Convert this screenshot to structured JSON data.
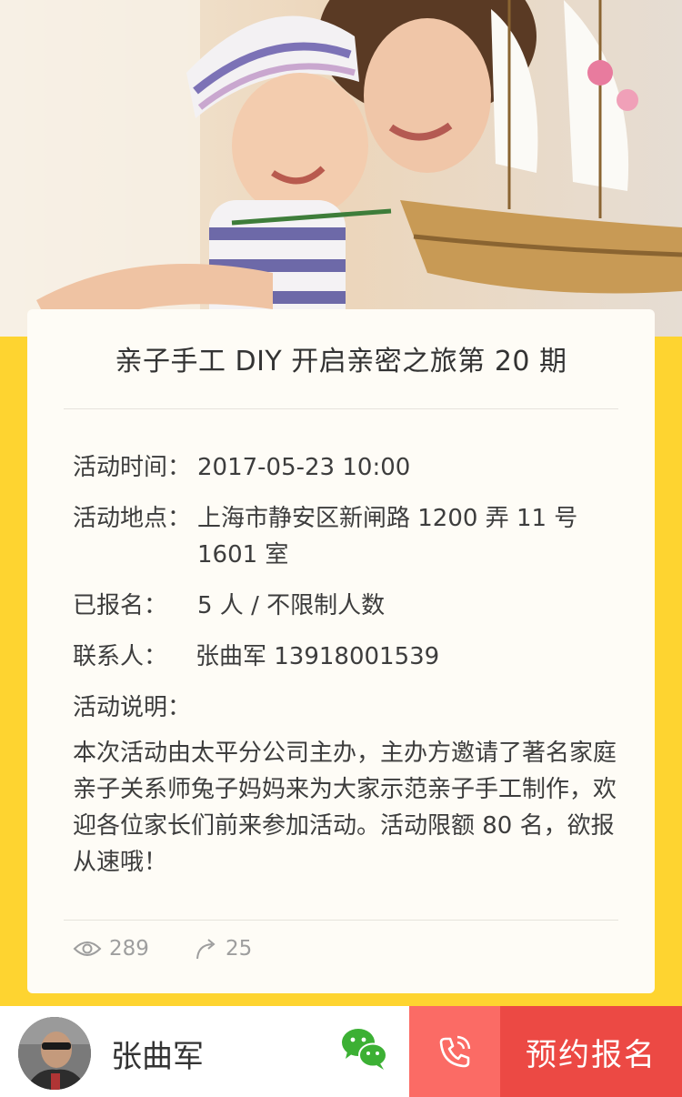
{
  "hero": {
    "image": "mother-and-child-painting-model-ship-photo"
  },
  "event": {
    "title": "亲子手工 DIY 开启亲密之旅第 20 期",
    "time_label": "活动时间：",
    "time_value": "2017-05-23  10:00",
    "location_label": "活动地点：",
    "location_line1": "上海市静安区新闸路 1200 弄 11 号",
    "location_line2": "1601 室",
    "signed_label": "已报名：",
    "signed_value": "5 人 / 不限制人数",
    "contact_label": "联系人：",
    "contact_value": "张曲军   13918001539",
    "desc_label": "活动说明：",
    "desc_text": "本次活动由太平分公司主办，主办方邀请了著名家庭亲子关系师兔子妈妈来为大家示范亲子手工制作，欢迎各位家长们前来参加活动。活动限额 80 名，欲报从速哦！",
    "views": "289",
    "shares": "25"
  },
  "footer": {
    "user_name": "张曲军",
    "signup_label": "预约报名"
  },
  "colors": {
    "background": "#fed430",
    "call_button": "#fb6b65",
    "signup_button": "#ec4944",
    "wechat_green": "#3cb034"
  },
  "icons": [
    "eye-icon",
    "share-icon",
    "wechat-icon",
    "phone-icon"
  ]
}
